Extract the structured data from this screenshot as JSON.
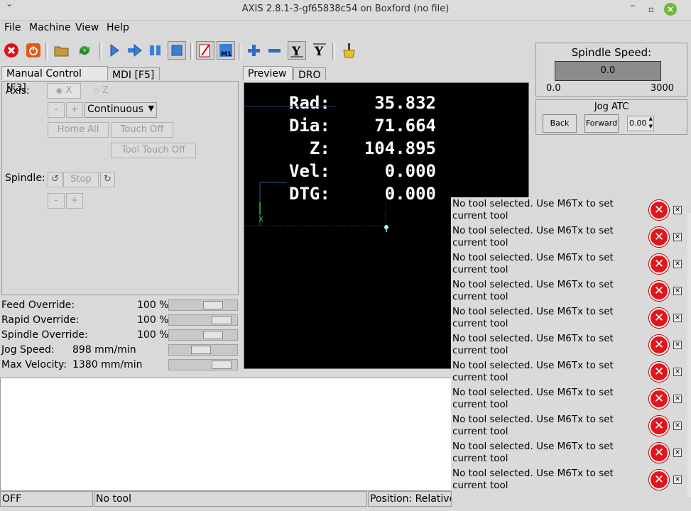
{
  "window": {
    "title": "AXIS 2.8.1-3-gf65838c54 on Boxford (no file)"
  },
  "menubar": [
    {
      "label": "File"
    },
    {
      "label": "Machine"
    },
    {
      "label": "View"
    },
    {
      "label": "Help"
    }
  ],
  "toolbar": {
    "icons": [
      "estop-icon",
      "machine-power-icon",
      "open-file-icon",
      "reload-icon",
      "run-icon",
      "step-icon",
      "pause-icon",
      "stop-icon",
      "block-delete-icon",
      "optional-stop-icon",
      "zoom-in-icon",
      "zoom-out-icon",
      "view-y-icon",
      "view-y2-icon",
      "clear-plot-icon"
    ]
  },
  "tabs": {
    "manual": "Manual Control [F3]",
    "mdi": "MDI [F5]",
    "preview": "Preview",
    "dro": "DRO"
  },
  "manual": {
    "axis_label": "Axis:",
    "axis_x": "X",
    "axis_z": "Z",
    "minus": "-",
    "plus": "+",
    "jog_mode": "Continuous",
    "home_all": "Home All",
    "touch_off": "Touch Off",
    "tool_touch_off": "Tool Touch Off",
    "spindle_label": "Spindle:",
    "stop": "Stop"
  },
  "overrides": [
    {
      "label": "Feed Override:",
      "value": "100 %",
      "level": 0.7
    },
    {
      "label": "Rapid Override:",
      "value": "100 %",
      "level": 0.88
    },
    {
      "label": "Spindle Override:",
      "value": "100 %",
      "level": 0.7
    },
    {
      "label": "Jog Speed:",
      "value": "898 mm/min",
      "level": 0.45
    },
    {
      "label": "Max Velocity:",
      "value": "1380 mm/min",
      "level": 0.88
    }
  ],
  "dro": [
    {
      "label": "Rad:",
      "value": "35.832"
    },
    {
      "label": "Dia:",
      "value": "71.664"
    },
    {
      "label": "  Z:",
      "value": "104.895"
    },
    {
      "label": "Vel:",
      "value": "0.000"
    },
    {
      "label": "DTG:",
      "value": "0.000"
    }
  ],
  "preview": {
    "axis_marker": "X"
  },
  "spindle_speed": {
    "title": "Spindle Speed:",
    "value": "0.0",
    "min": "0.0",
    "max": "3000"
  },
  "jog_atc": {
    "title": "Jog ATC",
    "back": "Back",
    "forward": "Forward",
    "spin_value": "0.00"
  },
  "notifications": {
    "message": "No tool selected. Use M6Tx to set current tool",
    "count": 11
  },
  "statusbar": {
    "state": "OFF",
    "tool": "No tool",
    "position": "Position: Relative Actual"
  }
}
